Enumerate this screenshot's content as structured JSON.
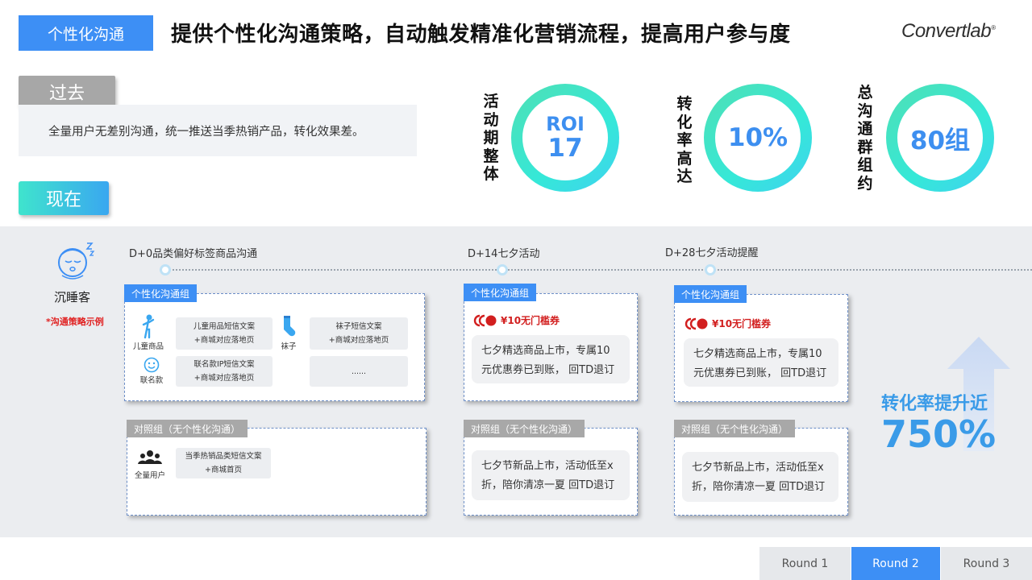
{
  "header": {
    "tag": "个性化沟通",
    "title": "提供个性化沟通策略，自动触发精准化营销流程，提高用户参与度",
    "logo": "Convertlab"
  },
  "past": {
    "tag": "过去",
    "text": "全量用户无差别沟通，统一推送当季热销产品，转化效果差。"
  },
  "now": {
    "tag": "现在"
  },
  "metrics": [
    {
      "label_chars": [
        "活",
        "动",
        "期",
        "整",
        "体"
      ],
      "value_top": "ROI",
      "value": "17"
    },
    {
      "label_chars": [
        "转",
        "化",
        "率",
        "高",
        "达"
      ],
      "value_top": "",
      "value": "10%"
    },
    {
      "label_chars": [
        "总",
        "沟",
        "通",
        "群",
        "组",
        "约"
      ],
      "value_top": "",
      "value": "80组"
    }
  ],
  "persona": {
    "name": "沉睡客",
    "note": "*沟通策略示例"
  },
  "stages": [
    "D+0品类偏好标签商品沟通",
    "D+14七夕活动",
    "D+28七夕活动提醒"
  ],
  "group_label": "个性化沟通组",
  "control_label": "对照组（无个性化沟通）",
  "stage1": {
    "kids_icon_label": "儿童商品",
    "kids_msg_line1": "儿童用品短信文案",
    "kids_msg_line2": "+商城对应落地页",
    "socks_icon_label": "袜子",
    "socks_msg_line1": "袜子短信文案",
    "socks_msg_line2": "+商城对应落地页",
    "collab_icon_label": "联名款",
    "collab_msg_line1": "联名款IP短信文案",
    "collab_msg_line2": "+商城对应落地页",
    "more": "......",
    "all_users_label": "全量用户",
    "control_msg_line1": "当季热销品类短信文案",
    "control_msg_line2": "+商城首页"
  },
  "coupon_text": "¥10无门槛券",
  "personal_msg": "七夕精选商品上市，专属10元优惠券已到账， 回TD退订",
  "control_msg": "七夕节新品上市，活动低至x折，陪你清凉一夏 回TD退订",
  "lift": {
    "label": "转化率提升近",
    "value": "750%"
  },
  "rounds": {
    "items": [
      "Round 1",
      "Round 2",
      "Round 3"
    ],
    "active": "Round 2"
  },
  "colors": {
    "primary_blue": "#3d8ff5",
    "ring_gradient_start": "#4fe0b4",
    "ring_gradient_end": "#3fd2f0",
    "coupon_red": "#d21f1f",
    "lift_blue": "#3a9be8"
  }
}
